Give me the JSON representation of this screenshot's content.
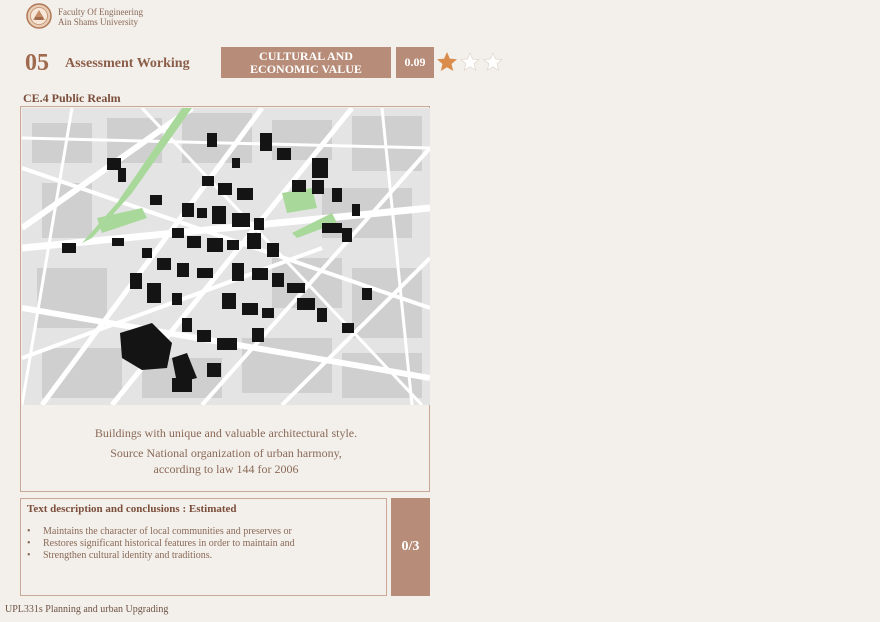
{
  "header": {
    "university_line1": "Faculty Of Engineering",
    "university_line2": "Ain Shams University",
    "section_number": "05",
    "section_title": "Assessment Working",
    "category_line1": "CULTURAL AND",
    "category_line2": "ECONOMIC VALUE",
    "score": "0.09",
    "rating": {
      "value": 1,
      "max": 3
    }
  },
  "criterion": {
    "title": "CE.4 Public Realm"
  },
  "map": {
    "caption_line1": "Buildings with unique and valuable architectural style.",
    "caption_line2": "Source National organization of urban harmony,",
    "caption_line3": "according to law 144 for 2006",
    "colors": {
      "background": "#e4e4e4",
      "streets": "#ffffff",
      "buildings": "#141414",
      "parks": "#a8d99a",
      "blocks": "#c9c9c9"
    }
  },
  "description": {
    "title": "Text description and conclusions : Estimated",
    "bullets": [
      "Maintains the character of local communities and preserves or",
      "Restores significant historical features in order to maintain and",
      "Strengthen cultural identity and traditions."
    ],
    "result": "0/3"
  },
  "footer": {
    "course": "UPL331s Planning and urban Upgrading"
  },
  "colors": {
    "accent": "#b78c78",
    "title": "#a06a4e",
    "background": "#f3efea",
    "star_filled": "#d98c4c",
    "star_empty": "#ffffff"
  }
}
